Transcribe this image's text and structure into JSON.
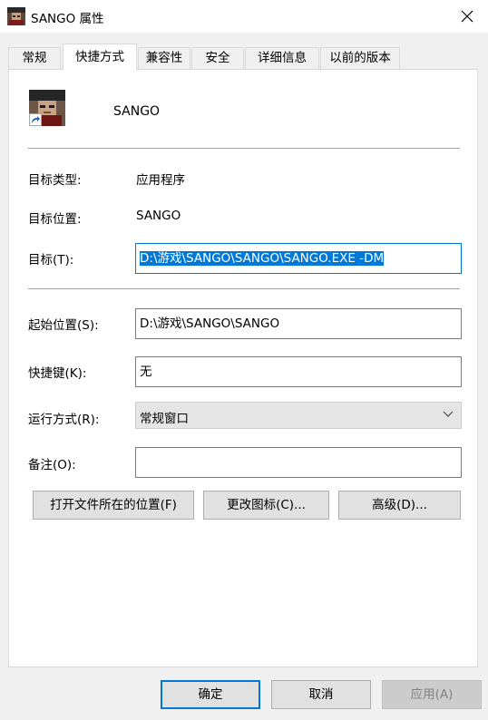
{
  "window": {
    "title": "SANGO 属性",
    "close_icon": "close-icon"
  },
  "tabs": [
    {
      "label": "常规",
      "active": false
    },
    {
      "label": "快捷方式",
      "active": true
    },
    {
      "label": "兼容性",
      "active": false
    },
    {
      "label": "安全",
      "active": false
    },
    {
      "label": "详细信息",
      "active": false
    },
    {
      "label": "以前的版本",
      "active": false
    }
  ],
  "shortcut": {
    "icon": "sango-app-icon",
    "name": "SANGO",
    "target_type_label": "目标类型:",
    "target_type_value": "应用程序",
    "target_location_label": "目标位置:",
    "target_location_value": "SANGO",
    "target_label": "目标(T):",
    "target_value": "D:\\游戏\\SANGO\\SANGO\\SANGO.EXE -DM",
    "start_in_label": "起始位置(S):",
    "start_in_value": "D:\\游戏\\SANGO\\SANGO",
    "hotkey_label": "快捷键(K):",
    "hotkey_value": "无",
    "run_label": "运行方式(R):",
    "run_value": "常规窗口",
    "comment_label": "备注(O):",
    "comment_value": ""
  },
  "actions": {
    "open_location": "打开文件所在的位置(F)",
    "change_icon": "更改图标(C)...",
    "advanced": "高级(D)..."
  },
  "footer": {
    "ok": "确定",
    "cancel": "取消",
    "apply": "应用(A)"
  },
  "colors": {
    "accent": "#0078d7",
    "panel_bg": "#ffffff",
    "window_bg": "#f0f0f0",
    "button_bg": "#e1e1e1"
  }
}
